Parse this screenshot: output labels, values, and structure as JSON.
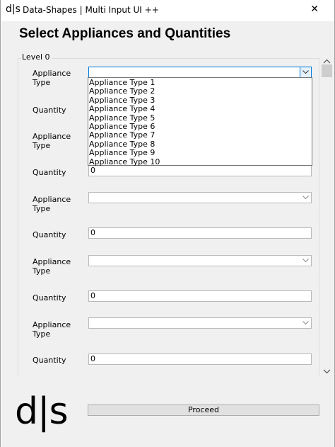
{
  "window": {
    "app_icon_text": "d|s",
    "title": "Data-Shapes | Multi Input UI ++",
    "close_glyph": "✕"
  },
  "header": {
    "title": "Select Appliances and Quantities"
  },
  "level": {
    "label": "Level 0",
    "rows": [
      {
        "appliance_label": "Appliance Type",
        "quantity_label": "Quantity",
        "quantity_value": ""
      },
      {
        "appliance_label": "Appliance Type",
        "quantity_label": "Quantity",
        "quantity_value": "0"
      },
      {
        "appliance_label": "Appliance Type",
        "quantity_label": "Quantity",
        "quantity_value": "0"
      },
      {
        "appliance_label": "Appliance Type",
        "quantity_label": "Quantity",
        "quantity_value": "0"
      },
      {
        "appliance_label": "Appliance Type",
        "quantity_label": "Quantity",
        "quantity_value": "0"
      }
    ]
  },
  "dropdown": {
    "options": [
      "Appliance Type 1",
      "Appliance Type 2",
      "Appliance Type 3",
      "Appliance Type 4",
      "Appliance Type 5",
      "Appliance Type 6",
      "Appliance Type 7",
      "Appliance Type 8",
      "Appliance Type 9",
      "Appliance Type 10"
    ]
  },
  "footer": {
    "logo_text": "d|s",
    "proceed_label": "Proceed"
  },
  "icons": {
    "dropdown_arrow": "chevron-down-icon",
    "scroll_up": "chevron-up-icon",
    "scroll_down": "chevron-down-icon"
  },
  "colors": {
    "focus_border": "#0078d7",
    "panel_bg": "#f0f0f0",
    "button_bg": "#e1e1e1"
  }
}
